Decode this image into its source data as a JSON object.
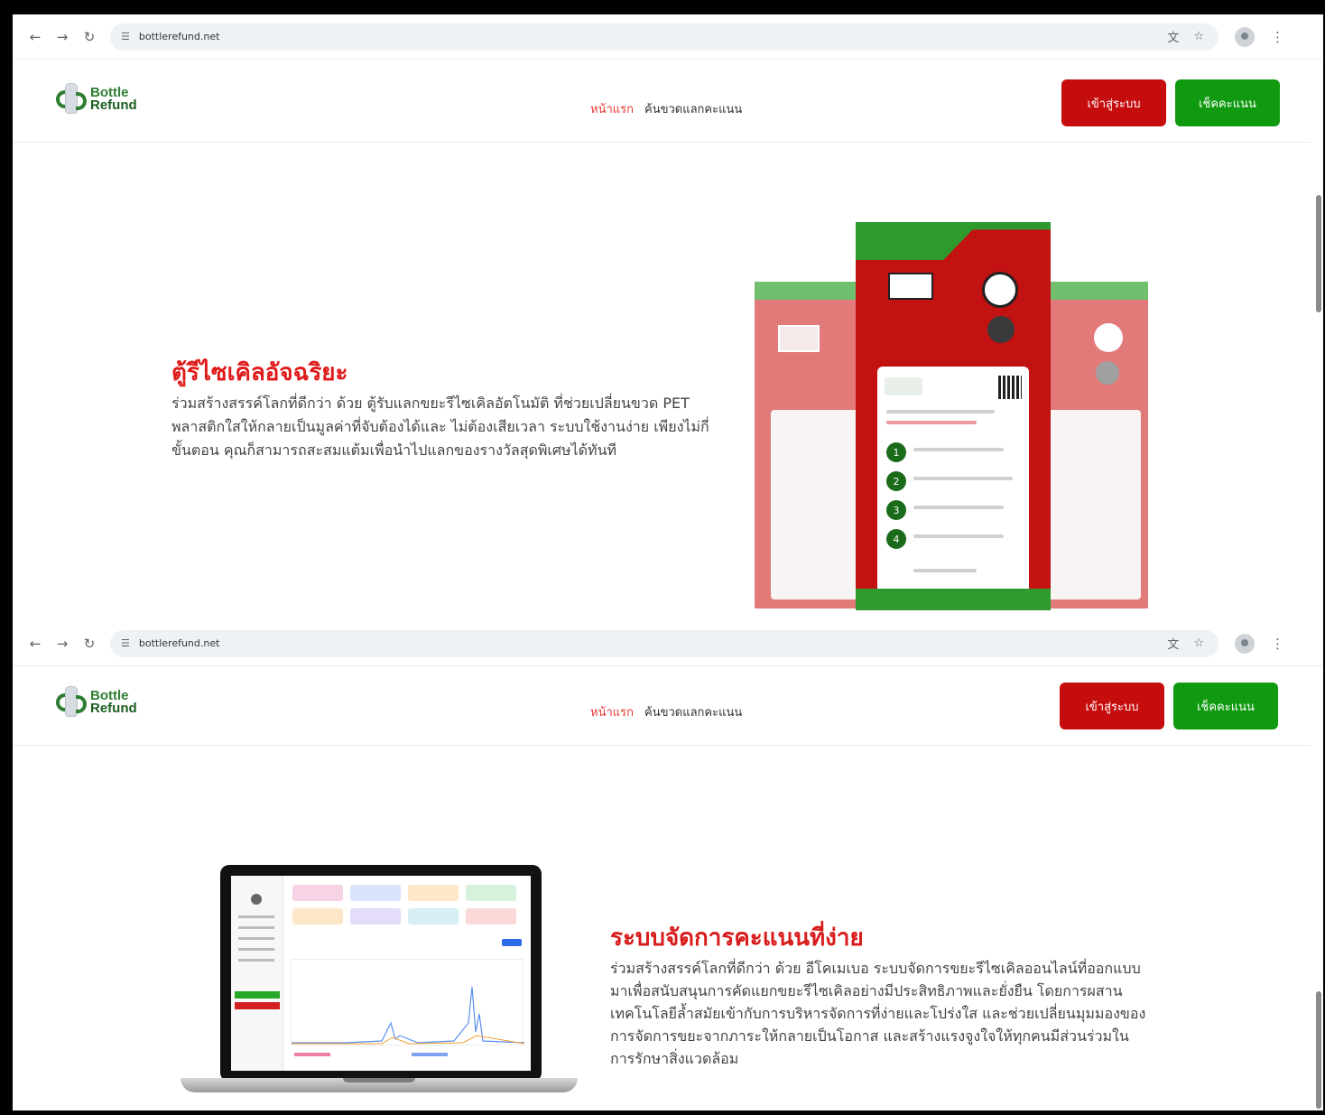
{
  "browser": {
    "url": "bottlerefund.net",
    "icons": [
      "back-arrow-icon",
      "forward-arrow-icon",
      "reload-icon",
      "site-info-icon",
      "translate-icon",
      "bookmark-star-icon",
      "profile-icon",
      "menu-kebab-icon"
    ]
  },
  "site": {
    "logo": {
      "line1": "Bottle",
      "line2": "Refund"
    },
    "nav": {
      "home": "หน้าแรก",
      "check_bottles": "ค้นขวดแลกคะแนน"
    },
    "buttons": {
      "login": "เข้าสู่ระบบ",
      "check_points": "เช็คคะแนน"
    },
    "colors": {
      "primary_red": "#c60d0d",
      "primary_green": "#109a10",
      "heading_red": "#e01b1b"
    }
  },
  "section1": {
    "title": "ตู้รีไซเคิลอัจฉริยะ",
    "description": "ร่วมสร้างสรรค์โลกที่ดีกว่า ด้วย ตู้รับแลกขยะรีไซเคิลอัตโนมัติ ที่ช่วยเปลี่ยนขวด PET พลาสติกใสให้กลายเป็นมูลค่าที่จับต้องได้และ ไม่ต้องเสียเวลา ระบบใช้งานง่าย เพียงไม่กี่ขั้นตอน คุณก็สามารถสะสมแต้มเพื่อนำไปแลกของรางวัลสุดพิเศษได้ทันที",
    "kiosk_steps": [
      "1",
      "2",
      "3",
      "4"
    ]
  },
  "section2": {
    "title": "ระบบจัดการคะแนนที่ง่าย",
    "description": "ร่วมสร้างสรรค์โลกที่ดีกว่า ด้วย อีโคเมเบอ ระบบจัดการขยะรีไซเคิลออนไลน์ที่ออกแบบมาเพื่อสนับสนุนการคัดแยกขยะรีไซเคิลอย่างมีประสิทธิภาพและยั่งยืน โดยการผสานเทคโนโลยีล้ำสมัยเข้ากับการบริหารจัดการที่ง่ายและโปร่งใส และช่วยเปลี่ยนมุมมองของการจัดการขยะจากภาระให้กลายเป็นโอกาส และสร้างแรงจูงใจให้ทุกคนมีส่วนร่วมในการรักษาสิ่งแวดล้อม"
  }
}
